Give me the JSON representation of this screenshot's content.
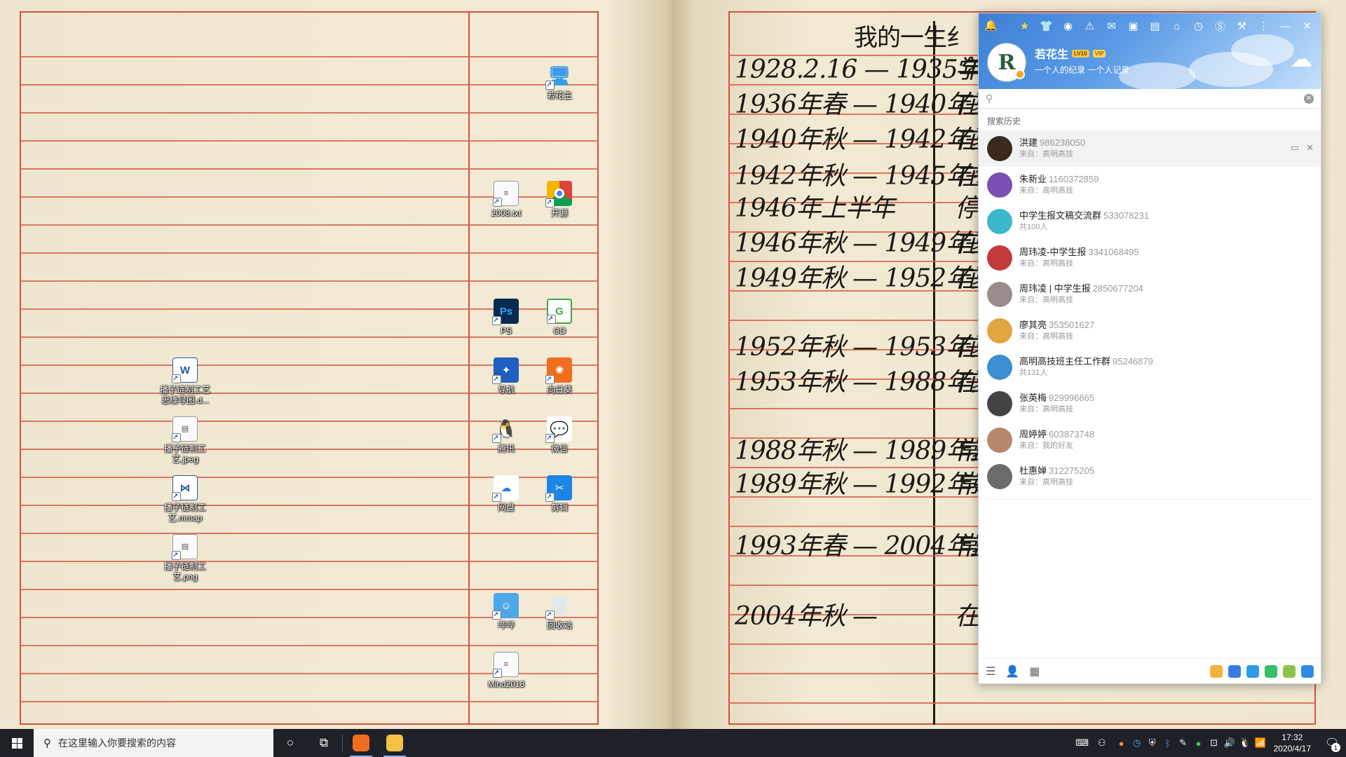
{
  "wallpaper": {
    "title_fragment": "我的一生纟",
    "entries": [
      "1928.2.16 — 1935年冬",
      "1936年春 — 1940年夏",
      "1940年秋 — 1942年夏",
      "1942年秋 — 1945年冬",
      "1946年上半年",
      "1946年秋 — 1949年夏",
      "1949年秋 — 1952年夏",
      "1952年秋 — 1953年夏",
      "1953年秋 — 1988年夏",
      "1988年秋 — 1989年夏",
      "1989年秋 — 1992年冬",
      "1993年春 — 2004年夏",
      "2004年秋 —"
    ],
    "side_glyphs": [
      "学",
      "在",
      "在",
      "在",
      "停",
      "在",
      "在",
      "在",
      "在",
      "常",
      "常",
      "常",
      "在"
    ]
  },
  "desktop_icons": [
    {
      "name": "若花生",
      "glyph": "🖥",
      "style": "g-pc",
      "icon": "computer-icon"
    },
    {
      "name": "2008.txt",
      "glyph": "≡",
      "style": "g-doc",
      "icon": "text-file-icon"
    },
    {
      "name": "开源",
      "glyph": "",
      "style": "g-chrome",
      "icon": "chrome-icon"
    },
    {
      "name": "PS",
      "glyph": "Ps",
      "style": "g-ps",
      "icon": "photoshop-icon"
    },
    {
      "name": "GD",
      "glyph": "G",
      "style": "g-gd",
      "icon": "gd-icon"
    },
    {
      "name": "导航",
      "glyph": "✦",
      "style": "g-map",
      "icon": "map-icon"
    },
    {
      "name": "向日葵",
      "glyph": "✺",
      "style": "g-xiang",
      "icon": "sunflower-icon"
    },
    {
      "name": "腾讯",
      "glyph": "🐧",
      "style": "g-qq",
      "icon": "qq-icon"
    },
    {
      "name": "微信",
      "glyph": "💬",
      "style": "g-wx",
      "icon": "wechat-icon"
    },
    {
      "name": "网盘",
      "glyph": "☁",
      "style": "g-pan",
      "icon": "cloud-drive-icon"
    },
    {
      "name": "剪辑",
      "glyph": "✂",
      "style": "g-cut",
      "icon": "video-editor-icon"
    },
    {
      "name": "哔哔",
      "glyph": "☺",
      "style": "g-bb",
      "icon": "bibi-icon"
    },
    {
      "name": "回收站",
      "glyph": "🗑",
      "style": "g-bin",
      "icon": "recycle-bin-icon"
    },
    {
      "name": "Mind2018",
      "glyph": "≡",
      "style": "g-doc",
      "icon": "mind-file-icon"
    },
    {
      "name": "播子链制工艺思维导图.d...",
      "glyph": "W",
      "style": "g-word",
      "icon": "word-file-icon"
    },
    {
      "name": "播子链制工艺.jpeg",
      "glyph": "▤",
      "style": "g-doc",
      "icon": "image-file-icon"
    },
    {
      "name": "播子链制工艺.mmap",
      "glyph": "⋈",
      "style": "g-word",
      "icon": "mindmap-file-icon"
    },
    {
      "name": "播子链制工艺.png",
      "glyph": "▤",
      "style": "g-doc",
      "icon": "png-file-icon"
    }
  ],
  "qq": {
    "nickname": "若花生",
    "level_badge": "LV16",
    "vip_badge": "VIP",
    "signature": "一个人的纪录 一个人记录",
    "avatar_letter": "R",
    "search_placeholder": "",
    "history_label": "搜索历史",
    "contacts": [
      {
        "name": "洪建",
        "number": "986238050",
        "sub": "来自：高明高技",
        "color": "#3a2a1e"
      },
      {
        "name": "朱新业",
        "number": "1160372859",
        "sub": "来自：高明高技",
        "color": "#7c4fb5"
      },
      {
        "name": "中学生报文稿交流群",
        "number": "533078231",
        "sub": "共100人",
        "color": "#3bb8c9"
      },
      {
        "name": "周玮凌-中学生报",
        "number": "3341068495",
        "sub": "来自：高明高技",
        "color": "#c23a3a"
      },
      {
        "name": "周玮凌 | 中学生报",
        "number": "2850677204",
        "sub": "来自：高明高技",
        "color": "#9a8c8c"
      },
      {
        "name": "廖其亮",
        "number": "353501627",
        "sub": "来自：高明高技",
        "color": "#e0a640"
      },
      {
        "name": "高明高技班主任工作群",
        "number": "95246879",
        "sub": "共131人",
        "color": "#3a8fd0"
      },
      {
        "name": "张英梅",
        "number": "929996865",
        "sub": "来自：高明高技",
        "color": "#444"
      },
      {
        "name": "周婷婷",
        "number": "603873748",
        "sub": "来自：我的好友",
        "color": "#b8866b"
      },
      {
        "name": "杜惠婵",
        "number": "312275205",
        "sub": "来自：高明高技",
        "color": "#6b6b6b"
      }
    ]
  },
  "taskbar": {
    "search_placeholder": "在这里输入你要搜索的内容",
    "time": "17:32",
    "date": "2020/4/17",
    "notif_count": "1"
  }
}
